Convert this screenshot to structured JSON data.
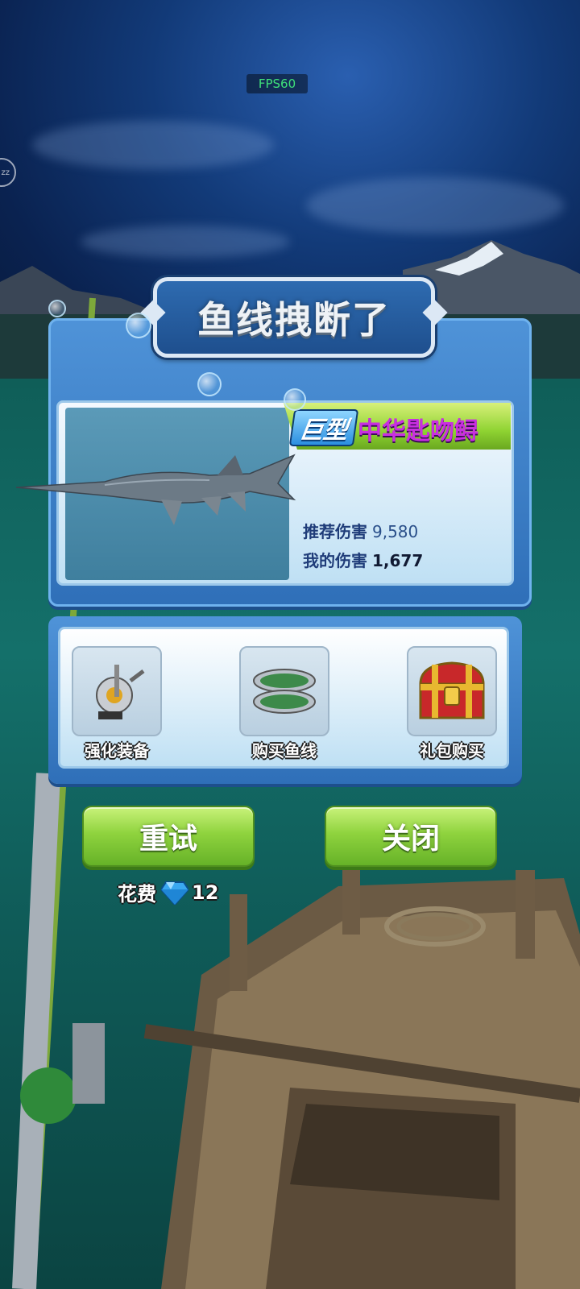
{
  "hud": {
    "fps": "FPS60",
    "sleep_badge": "zz"
  },
  "dialog": {
    "title": "鱼线拽断了",
    "fish": {
      "size_tag": "巨型",
      "name": "中华匙吻鲟",
      "recommended_damage_label": "推荐伤害",
      "recommended_damage": "9,580",
      "my_damage_label": "我的伤害",
      "my_damage": "1,677"
    },
    "options": [
      {
        "label": "强化装备",
        "icon": "fishing-reel-icon"
      },
      {
        "label": "购买鱼线",
        "icon": "fishing-line-spool-icon"
      },
      {
        "label": "礼包购买",
        "icon": "treasure-chest-icon"
      }
    ],
    "buttons": {
      "retry": "重试",
      "close": "关闭"
    },
    "cost": {
      "label": "花费",
      "icon": "diamond-icon",
      "amount": "12"
    }
  },
  "colors": {
    "tag_name": "#c92fe0",
    "button_green": "#8fd33e",
    "panel_blue": "#3f82c8"
  }
}
